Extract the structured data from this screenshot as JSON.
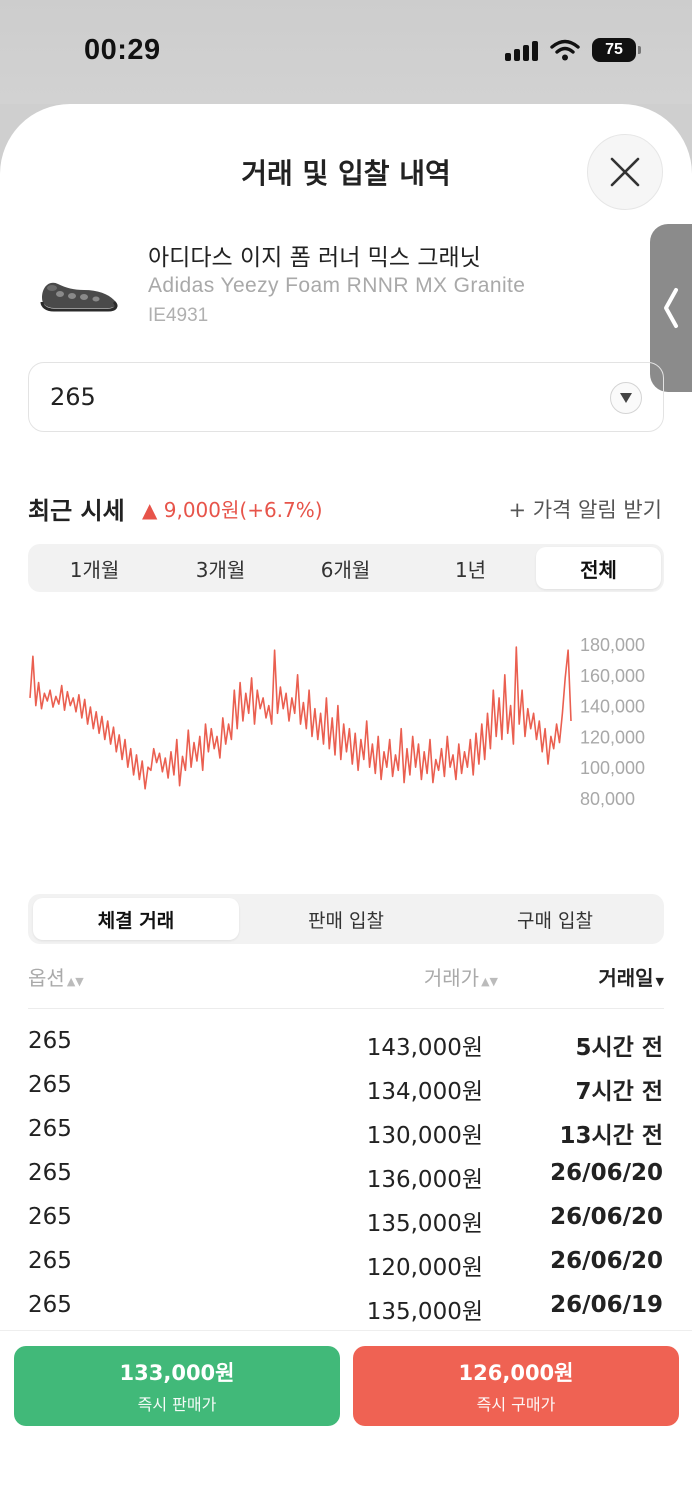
{
  "status_bar": {
    "time": "00:29",
    "battery": "75"
  },
  "header": {
    "title": "거래 및 입찰 내역"
  },
  "product": {
    "name_ko": "아디다스 이지 폼 러너 믹스 그래닛",
    "name_en": "Adidas Yeezy Foam RNNR MX Granite",
    "code": "IE4931"
  },
  "size_select": {
    "value": "265"
  },
  "recent": {
    "label": "최근 시세",
    "change": "▲ 9,000원(+6.7%)",
    "alert": "+ 가격 알림 받기"
  },
  "period_tabs": [
    {
      "label": "1개월"
    },
    {
      "label": "3개월"
    },
    {
      "label": "6개월"
    },
    {
      "label": "1년"
    },
    {
      "label": "전체"
    }
  ],
  "period_active": "전체",
  "chart_data": {
    "type": "line",
    "color": "#ea5f50",
    "y_ticks": [
      "180,000",
      "160,000",
      "140,000",
      "120,000",
      "100,000",
      "80,000"
    ],
    "ylim": [
      80000,
      180000
    ],
    "series": [
      {
        "values": [
          145000,
          172000,
          140000,
          155000,
          138000,
          148000,
          143000,
          150000,
          139000,
          146000,
          141000,
          153000,
          137000,
          149000,
          140000,
          145000,
          136000,
          147000,
          132000,
          144000,
          128000,
          139000,
          125000,
          136000,
          122000,
          133000,
          118000,
          130000,
          115000,
          126000,
          110000,
          121000,
          105000,
          118000,
          100000,
          112000,
          95000,
          108000,
          92000,
          104000,
          86000,
          100000,
          98000,
          112000,
          103000,
          109000,
          97000,
          106000,
          93000,
          110000,
          95000,
          118000,
          88000,
          107000,
          98000,
          124000,
          100000,
          116000,
          104000,
          120000,
          98000,
          128000,
          110000,
          125000,
          112000,
          120000,
          106000,
          132000,
          115000,
          128000,
          118000,
          150000,
          125000,
          155000,
          130000,
          148000,
          135000,
          158000,
          128000,
          150000,
          138000,
          145000,
          132000,
          140000,
          128000,
          176000,
          135000,
          152000,
          138000,
          148000,
          130000,
          145000,
          135000,
          160000,
          128000,
          142000,
          125000,
          150000,
          120000,
          138000,
          118000,
          135000,
          115000,
          145000,
          112000,
          132000,
          108000,
          140000,
          105000,
          128000,
          110000,
          125000,
          102000,
          122000,
          98000,
          118000,
          105000,
          130000,
          100000,
          115000,
          96000,
          120000,
          92000,
          110000,
          100000,
          118000,
          94000,
          108000,
          98000,
          125000,
          90000,
          112000,
          95000,
          120000,
          100000,
          115000,
          92000,
          110000,
          96000,
          118000,
          90000,
          105000,
          98000,
          112000,
          94000,
          120000,
          100000,
          108000,
          92000,
          115000,
          96000,
          110000,
          100000,
          118000,
          95000,
          122000,
          102000,
          128000,
          105000,
          135000,
          112000,
          150000,
          120000,
          145000,
          118000,
          160000,
          122000,
          140000,
          115000,
          178000,
          128000,
          150000,
          120000,
          138000,
          125000,
          135000,
          118000,
          130000,
          110000,
          125000,
          102000,
          120000,
          112000,
          128000,
          116000,
          135000,
          158000,
          176000,
          130000
        ]
      }
    ]
  },
  "trade_tabs": [
    {
      "label": "체결 거래"
    },
    {
      "label": "판매 입찰"
    },
    {
      "label": "구매 입찰"
    }
  ],
  "trade_active": "체결 거래",
  "table": {
    "headers": {
      "option": "옵션",
      "price": "거래가",
      "date": "거래일"
    },
    "rows": [
      {
        "size": "265",
        "price": "143,000원",
        "date": "5시간 전"
      },
      {
        "size": "265",
        "price": "134,000원",
        "date": "7시간 전"
      },
      {
        "size": "265",
        "price": "130,000원",
        "date": "13시간 전"
      },
      {
        "size": "265",
        "price": "136,000원",
        "date": "26/06/20"
      },
      {
        "size": "265",
        "price": "135,000원",
        "date": "26/06/20"
      },
      {
        "size": "265",
        "price": "120,000원",
        "date": "26/06/20"
      },
      {
        "size": "265",
        "price": "135,000원",
        "date": "26/06/19"
      }
    ]
  },
  "bottom": {
    "sell_price": "133,000원",
    "sell_label": "즉시 판매가",
    "buy_price": "126,000원",
    "buy_label": "즉시 구매가"
  },
  "colors": {
    "sell": "#41b979",
    "buy": "#ef6253",
    "rise": "#e7544a"
  }
}
